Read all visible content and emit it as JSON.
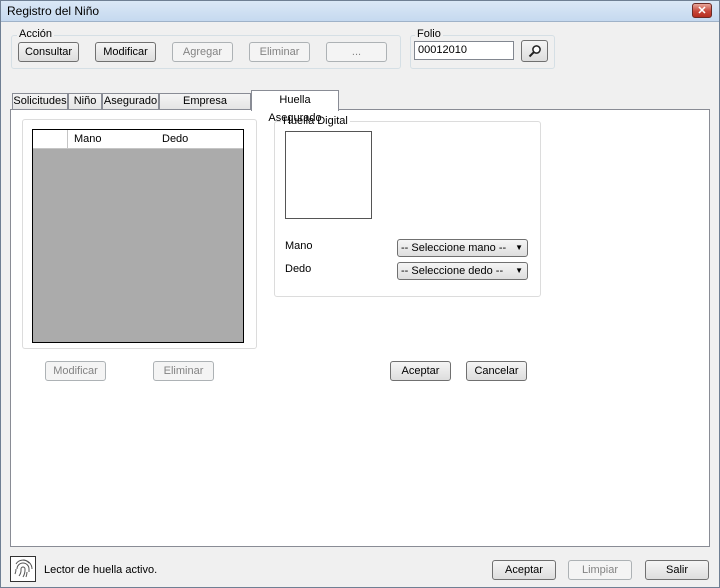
{
  "window": {
    "title": "Registro del Niño",
    "close_glyph": "✕"
  },
  "accion": {
    "label": "Acción",
    "consultar": "Consultar",
    "modificar": "Modificar",
    "agregar": "Agregar",
    "eliminar": "Eliminar",
    "more": "..."
  },
  "folio": {
    "label": "Folio",
    "value": "00012010",
    "search_icon": "search-icon"
  },
  "tabs": [
    {
      "label": "Solicitudes"
    },
    {
      "label": "Niño"
    },
    {
      "label": "Asegurado"
    },
    {
      "label": "Empresa Asegurado"
    },
    {
      "label": "Huella Asegurado",
      "active": true
    }
  ],
  "fingerprints_table": {
    "columns": [
      "Mano",
      "Dedo"
    ],
    "rows": []
  },
  "left_buttons": {
    "modificar": "Modificar",
    "eliminar": "Eliminar"
  },
  "huella": {
    "group_label": "Huella Digital",
    "mano_label": "Mano",
    "mano_value": "-- Seleccione mano --",
    "dedo_label": "Dedo",
    "dedo_value": "-- Seleccione dedo --"
  },
  "panel_buttons": {
    "aceptar": "Aceptar",
    "cancelar": "Cancelar"
  },
  "status": {
    "text": "Lector de huella activo.",
    "icon": "fingerprint-icon"
  },
  "footer_buttons": {
    "aceptar": "Aceptar",
    "limpiar": "Limpiar",
    "salir": "Salir"
  }
}
